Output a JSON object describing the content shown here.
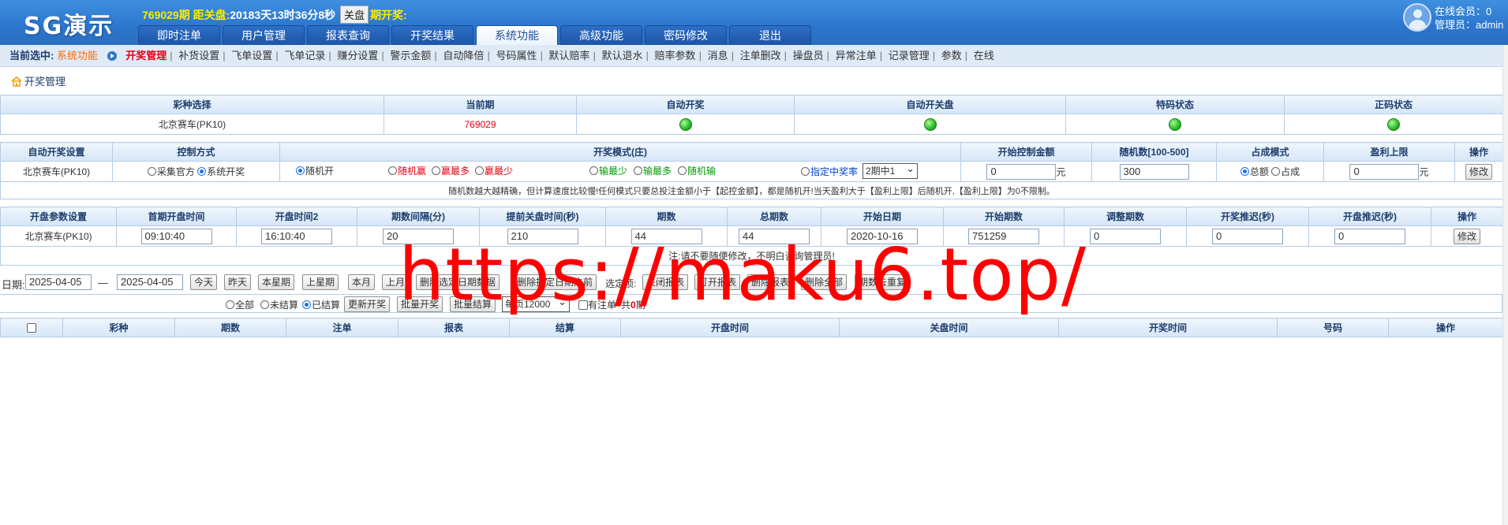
{
  "header": {
    "logo": "SG演示",
    "period": "769029期",
    "close_label": "距关盘:",
    "countdown": "20183天13时36分8秒",
    "close_button": "关盘",
    "draw_label": "期开奖:"
  },
  "nav": {
    "tabs": [
      "即时注单",
      "用户管理",
      "报表查询",
      "开奖结果",
      "系统功能",
      "高级功能",
      "密码修改",
      "退出"
    ],
    "active": "系统功能"
  },
  "user": {
    "online": "在线会员：0",
    "admin": "管理员：admin"
  },
  "subnav": {
    "current_label": "当前选中:",
    "current_value": "系统功能",
    "links": [
      "开奖管理",
      "补货设置",
      "飞单设置",
      "飞单记录",
      "赚分设置",
      "警示金额",
      "自动降倍",
      "号码属性",
      "默认赔率",
      "默认退水",
      "赔率参数",
      "消息",
      "注单删改",
      "操盘员",
      "异常注单",
      "记录管理",
      "参数",
      "在线"
    ]
  },
  "breadcrumb": "开奖管理",
  "status_table": {
    "headers": [
      "彩种选择",
      "当前期",
      "自动开奖",
      "自动开关盘",
      "特码状态",
      "正码状态"
    ],
    "lottery": "北京赛车(PK10)",
    "period": "769029"
  },
  "auto_table": {
    "headers": [
      "自动开奖设置",
      "控制方式",
      "开奖模式(庄)",
      "开始控制金额",
      "随机数[100-500]",
      "占成模式",
      "盈利上限",
      "操作"
    ],
    "lottery": "北京赛车(PK10)",
    "control_options": [
      "采集官方",
      "系统开奖"
    ],
    "modes": [
      "随机开",
      "随机赢",
      "赢最多",
      "赢最少",
      "输最少",
      "输最多",
      "随机输",
      "指定中奖率"
    ],
    "mode_select": "2期中1",
    "start_amount": "0",
    "unit_yuan": "元",
    "random_number": "300",
    "share_options": [
      "总额",
      "占成"
    ],
    "profit_limit": "0",
    "unit_yuan2": "元",
    "edit_button": "修改",
    "note": "随机数越大越精确，但计算速度比较慢!任何模式只要总投注金额小于【起控金额】，都是随机开!当天盈利大于【盈利上限】后随机开,【盈利上限】为0不限制。"
  },
  "param_table": {
    "headers": [
      "开盘参数设置",
      "首期开盘时间",
      "开盘时间2",
      "期数间隔(分)",
      "提前关盘时间(秒)",
      "期数",
      "总期数",
      "开始日期",
      "开始期数",
      "调整期数",
      "开奖推迟(秒)",
      "开盘推迟(秒)",
      "操作"
    ],
    "lottery": "北京赛车(PK10)",
    "first_open": "09:10:40",
    "open_time2": "16:10:40",
    "interval": "20",
    "early_close": "210",
    "periods": "44",
    "total_periods": "44",
    "start_date": "2020-10-16",
    "start_period": "751259",
    "adjust": "0",
    "draw_delay": "0",
    "open_delay": "0",
    "edit_button": "修改",
    "note": "注:请不要随便修改，不明白咨询管理员!"
  },
  "filter": {
    "date_label": "日期:",
    "date_from": "2025-04-05",
    "dash": "—",
    "date_to": "2025-04-05",
    "buttons": [
      "今天",
      "昨天",
      "本星期",
      "上星期",
      "本月",
      "上月",
      "删除选定日期数据",
      "删除指定日期之前",
      "选定项:",
      "关闭报表",
      "打开报表",
      "删除报表",
      "删除全部",
      "期数去重复"
    ],
    "status_options": [
      "全部",
      "未结算",
      "已结算"
    ],
    "update_button": "更新开奖",
    "batch_open": "批量开奖",
    "batch_settle": "批量结算",
    "page_size": "每页12000",
    "has_order": "有注单",
    "total_label": "共",
    "total_count": "0",
    "total_unit": "期"
  },
  "result_table": {
    "headers": [
      "彩种",
      "期数",
      "注单",
      "报表",
      "结算",
      "开盘时间",
      "关盘时间",
      "开奖时间",
      "号码",
      "操作"
    ]
  },
  "watermark": "https://maku6.top/"
}
